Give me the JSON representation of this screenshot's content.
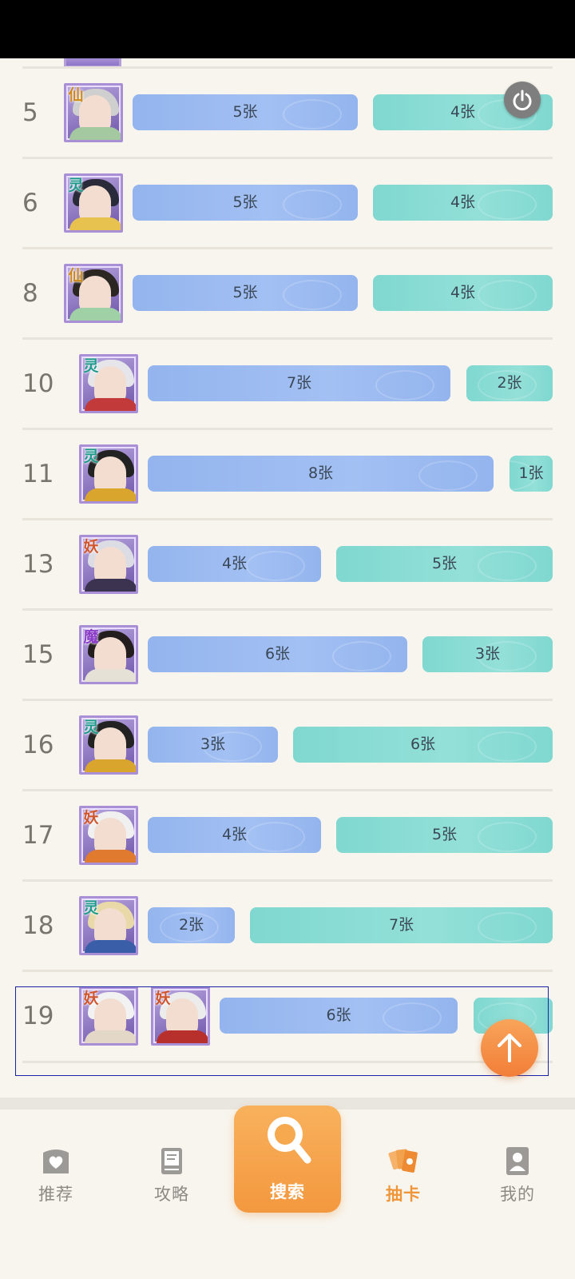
{
  "rows": [
    {
      "rank": "5",
      "avatars": [
        {
          "badge": "仙",
          "badge_color": "#d08a1c",
          "hair": "#cfcfcf",
          "robe": "#a4c8a0"
        }
      ],
      "blue": "5张",
      "teal": "4张",
      "blue_w": 276,
      "teal_w": 220
    },
    {
      "rank": "6",
      "avatars": [
        {
          "badge": "灵",
          "badge_color": "#1d9a8c",
          "hair": "#2a2b3a",
          "robe": "#e7c24e"
        }
      ],
      "blue": "5张",
      "teal": "4张"
    },
    {
      "rank": "8",
      "avatars": [
        {
          "badge": "仙",
          "badge_color": "#d08a1c",
          "hair": "#2b2622",
          "robe": "#9fd0a6"
        }
      ],
      "blue": "5张",
      "teal": "4张"
    },
    {
      "rank": "10",
      "avatars": [
        {
          "badge": "灵",
          "badge_color": "#1d9a8c",
          "hair": "#e5e5ea",
          "robe": "#c23a3a"
        }
      ],
      "blue": "7张",
      "teal": "2张"
    },
    {
      "rank": "11",
      "avatars": [
        {
          "badge": "灵",
          "badge_color": "#1d9a8c",
          "hair": "#222",
          "robe": "#d9a52c"
        }
      ],
      "blue": "8张",
      "teal": "1张"
    },
    {
      "rank": "13",
      "avatars": [
        {
          "badge": "妖",
          "badge_color": "#d0552d",
          "hair": "#dcdce4",
          "robe": "#3b3350"
        }
      ],
      "blue": "4张",
      "teal": "5张"
    },
    {
      "rank": "15",
      "avatars": [
        {
          "badge": "魔",
          "badge_color": "#8a3cc8",
          "hair": "#241d1d",
          "robe": "#e5e1d7"
        }
      ],
      "blue": "6张",
      "teal": "3张"
    },
    {
      "rank": "16",
      "avatars": [
        {
          "badge": "灵",
          "badge_color": "#1d9a8c",
          "hair": "#222",
          "robe": "#d9a52c"
        }
      ],
      "blue": "3张",
      "teal": "6张"
    },
    {
      "rank": "17",
      "avatars": [
        {
          "badge": "妖",
          "badge_color": "#d0552d",
          "hair": "#f0f0f0",
          "robe": "#e07a2e"
        }
      ],
      "blue": "4张",
      "teal": "5张"
    },
    {
      "rank": "18",
      "avatars": [
        {
          "badge": "灵",
          "badge_color": "#1d9a8c",
          "hair": "#e9d9a8",
          "robe": "#3a5ea8"
        }
      ],
      "blue": "2张",
      "teal": "7张"
    },
    {
      "rank": "19",
      "avatars": [
        {
          "badge": "妖",
          "badge_color": "#d0552d",
          "hair": "#f2f2f2",
          "robe": "#e3d7c8"
        },
        {
          "badge": "妖",
          "badge_color": "#d0552d",
          "hair": "#ececec",
          "robe": "#b8302c"
        }
      ],
      "blue": "6张",
      "teal": ""
    }
  ],
  "tabs": [
    {
      "label": "推荐",
      "icon": "heart-book-icon"
    },
    {
      "label": "攻略",
      "icon": "guide-book-icon"
    },
    {
      "label": "搜索",
      "icon": "search-icon"
    },
    {
      "label": "抽卡",
      "icon": "cards-icon"
    },
    {
      "label": "我的",
      "icon": "profile-icon"
    }
  ],
  "colors": {
    "accent": "#f3983f",
    "blue_bar": "#93b4ee",
    "teal_bar": "#7fd8d0",
    "background": "#f8f5ee"
  }
}
